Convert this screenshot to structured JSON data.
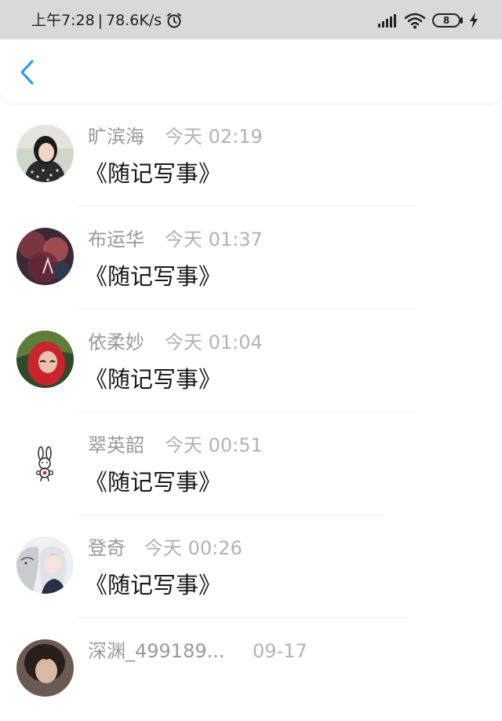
{
  "status_bar": {
    "time": "上午7:28",
    "separator": "|",
    "network_speed": "78.6K/s",
    "battery_level": "8",
    "icons": [
      "alarm-icon",
      "signal-icon",
      "wifi-icon",
      "battery-icon",
      "charging-icon"
    ]
  },
  "nav": {
    "back_icon": "chevron-left-icon",
    "accent_color": "#2196f3"
  },
  "items": [
    {
      "name": "旷滨海",
      "time": "今天 02:19",
      "content": "《随记写事》",
      "avatar": "photo-girl"
    },
    {
      "name": "布运华",
      "time": "今天 01:37",
      "content": "《随记写事》",
      "avatar": "abstract-red"
    },
    {
      "name": "依柔妙",
      "time": "今天 01:04",
      "content": "《随记写事》",
      "avatar": "portrait-red"
    },
    {
      "name": "翠英韶",
      "time": "今天 00:51",
      "content": "《随记写事》",
      "avatar": "bunny-doodle"
    },
    {
      "name": "登奇",
      "time": "今天 00:26",
      "content": "《随记写事》",
      "avatar": "anime-tiger"
    },
    {
      "name": "深渊_499189...",
      "time": "09-17",
      "content": "",
      "avatar": "portrait-dark"
    }
  ]
}
